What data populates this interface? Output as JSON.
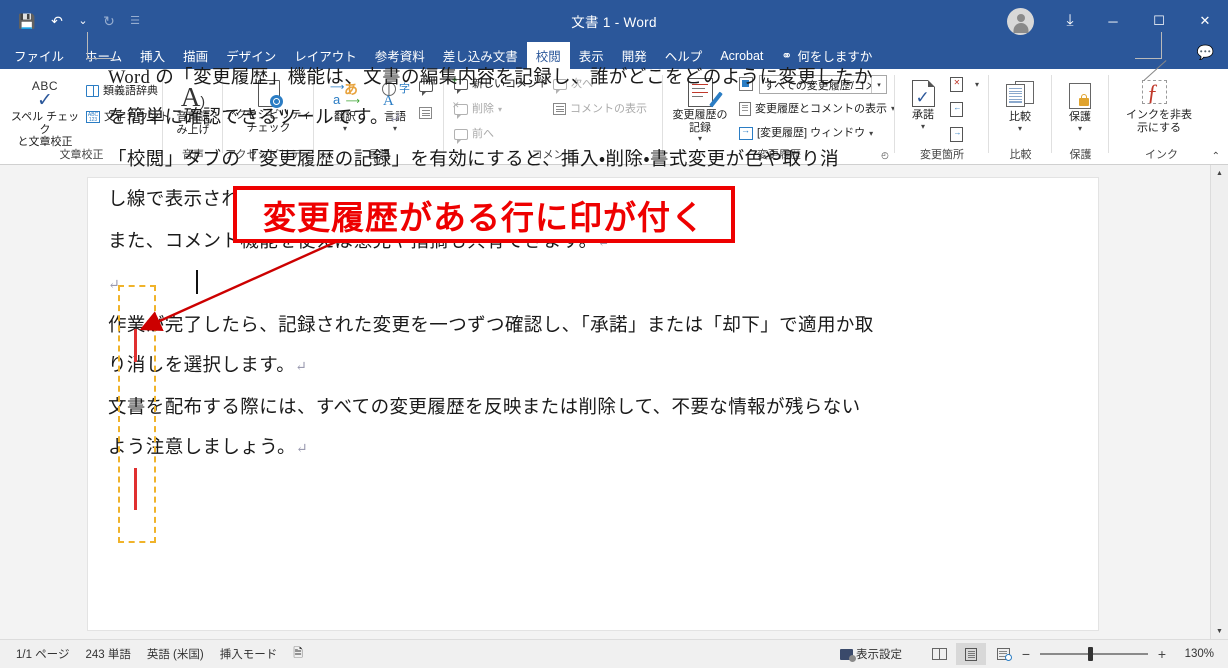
{
  "window": {
    "title": "文書 1  -  Word",
    "quick_access": [
      {
        "name": "save",
        "glyph": "💾"
      },
      {
        "name": "undo",
        "glyph": "↶"
      },
      {
        "name": "undo-dropdown",
        "glyph": "⌄"
      },
      {
        "name": "redo",
        "glyph": "↻"
      },
      {
        "name": "customize-qat",
        "glyph": "☰"
      }
    ],
    "controls": {
      "ribbon_display_options": "⤓",
      "minimize": "─",
      "maximize": "☐",
      "close": "✕",
      "comment_flag": "💬"
    }
  },
  "tabs": [
    {
      "label": "ファイル",
      "active": false
    },
    {
      "label": "ホーム",
      "active": false
    },
    {
      "label": "挿入",
      "active": false
    },
    {
      "label": "描画",
      "active": false
    },
    {
      "label": "デザイン",
      "active": false
    },
    {
      "label": "レイアウト",
      "active": false
    },
    {
      "label": "参考資料",
      "active": false
    },
    {
      "label": "差し込み文書",
      "active": false
    },
    {
      "label": "校閲",
      "active": true
    },
    {
      "label": "表示",
      "active": false
    },
    {
      "label": "開発",
      "active": false
    },
    {
      "label": "ヘルプ",
      "active": false
    },
    {
      "label": "Acrobat",
      "active": false
    }
  ],
  "tell_me": "何をしますか",
  "ribbon": {
    "groups": [
      {
        "name": "proofing",
        "label": "文章校正",
        "big_buttons": [
          {
            "name": "spelling-grammar",
            "label": "スペル チェック\nと文章校正",
            "icon": "abc-check-icon"
          }
        ],
        "small_buttons": [
          {
            "name": "thesaurus",
            "label": "類義語辞典",
            "icon": "book-icon",
            "disabled": false
          },
          {
            "name": "word-count",
            "label": "文字カウント",
            "icon": "abc123-icon",
            "disabled": false
          }
        ]
      },
      {
        "name": "speech",
        "label": "音声",
        "big_buttons": [
          {
            "name": "read-aloud",
            "label": "音声読\nみ上げ",
            "icon": "speaker-a-icon"
          }
        ],
        "small_buttons": []
      },
      {
        "name": "accessibility",
        "label": "アクセシビリティ",
        "big_buttons": [
          {
            "name": "check-accessibility",
            "label": "アクセシビリティ\nチェック",
            "icon": "accessibility-doc-icon",
            "has_chevron": true
          }
        ],
        "small_buttons": []
      },
      {
        "name": "language",
        "label": "言語",
        "big_buttons": [
          {
            "name": "translate",
            "label": "翻訳",
            "icon": "translate-icon",
            "has_chevron": true
          },
          {
            "name": "language",
            "label": "言語",
            "icon": "language-icon",
            "has_chevron": true
          }
        ],
        "small_buttons": []
      },
      {
        "name": "comments",
        "label": "コメント",
        "big_buttons": [],
        "small_buttons": [
          {
            "name": "new-comment",
            "label": "新しいコメント",
            "icon": "comment-add-icon",
            "disabled": false
          },
          {
            "name": "delete-comment",
            "label": "削除",
            "icon": "comment-delete-icon",
            "disabled": true,
            "has_chevron": true
          },
          {
            "name": "previous-comment",
            "label": "前へ",
            "icon": "comment-prev-icon",
            "disabled": true
          },
          {
            "name": "next-comment",
            "label": "次へ",
            "icon": "comment-next-icon",
            "disabled": true
          },
          {
            "name": "show-comments",
            "label": "コメントの表示",
            "icon": "comment-show-icon",
            "disabled": true
          }
        ]
      },
      {
        "name": "tracking",
        "label": "変更履歴",
        "big_buttons": [
          {
            "name": "track-changes",
            "label": "変更履歴の\n記録",
            "icon": "track-changes-icon",
            "has_chevron": true
          }
        ],
        "markup_combo": "すべての変更履歴/コメ…",
        "small_buttons": [
          {
            "name": "show-markup",
            "label": "変更履歴とコメントの表示",
            "icon": "show-markup-icon",
            "has_chevron": true
          },
          {
            "name": "reviewing-pane",
            "label": "[変更履歴] ウィンドウ",
            "icon": "reviewing-pane-icon",
            "has_chevron": true
          }
        ],
        "has_dialog_launcher": true
      },
      {
        "name": "changes",
        "label": "変更箇所",
        "big_buttons": [
          {
            "name": "accept",
            "label": "承諾",
            "icon": "accept-icon",
            "has_chevron": true
          }
        ],
        "small_buttons": [
          {
            "name": "reject",
            "label": "",
            "icon": "reject-icon",
            "has_chevron": true
          },
          {
            "name": "previous-change",
            "label": "",
            "icon": "previous-change-icon"
          },
          {
            "name": "next-change",
            "label": "",
            "icon": "next-change-icon"
          }
        ]
      },
      {
        "name": "compare",
        "label": "比較",
        "big_buttons": [
          {
            "name": "compare",
            "label": "比較",
            "icon": "compare-icon",
            "has_chevron": true
          }
        ],
        "small_buttons": []
      },
      {
        "name": "protect",
        "label": "保護",
        "big_buttons": [
          {
            "name": "protect",
            "label": "保護",
            "icon": "protect-lock-icon",
            "has_chevron": true
          }
        ],
        "small_buttons": []
      },
      {
        "name": "ink",
        "label": "インク",
        "big_buttons": [
          {
            "name": "hide-ink",
            "label": "インクを非表\n示にする",
            "icon": "hide-ink-icon",
            "has_chevron": true
          }
        ],
        "small_buttons": []
      }
    ],
    "collapse_glyph": "⌃"
  },
  "annotation": {
    "callout_text": "変更履歴がある行に印が付く",
    "callout_border_color": "#ee0000",
    "callout_text_color": "#ee0000",
    "highlight_box_color": "#f0b32a",
    "arrow_color": "#cc0000"
  },
  "document": {
    "change_bar_color": "#e03030",
    "paragraphs": [
      {
        "name": "para-1-line-1",
        "text": "Word の「変更履歴」機能は、文書の編集内容を記録し、誰がどこをどのように変更したか",
        "pilcrow": false
      },
      {
        "name": "para-1-line-2",
        "text": "を簡単に確認できるツールです。",
        "pilcrow": true
      },
      {
        "name": "para-2-line-1",
        "text": "「校閲」タブの「変更履歴の記録」を有効にすると、挿入・削除・書式変更が色や取り消",
        "pilcrow": false
      },
      {
        "name": "para-2-line-2",
        "text": "し線で表示され、編集内容が一目でわかります。",
        "pilcrow": true
      },
      {
        "name": "para-3",
        "text": "また、コメント機能を使えば意見や指摘も共有できます。",
        "pilcrow": true
      },
      {
        "name": "para-empty",
        "text": "",
        "pilcrow": true
      },
      {
        "name": "para-4-line-1",
        "text": "作業が完了したら、記録された変更を一つずつ確認し、「承諾」または「却下」で適用か取",
        "pilcrow": false
      },
      {
        "name": "para-4-line-2",
        "text": "り消しを選択します。",
        "pilcrow": true
      },
      {
        "name": "para-5-line-1",
        "text": "文書を配布する際には、すべての変更履歴を反映または削除して、不要な情報が残らない",
        "pilcrow": false
      },
      {
        "name": "para-5-line-2",
        "text": "よう注意しましょう。",
        "pilcrow": true
      }
    ]
  },
  "status_bar": {
    "page": "1/1 ページ",
    "words": "243 単語",
    "language": "英語 (米国)",
    "mode": "挿入モード",
    "proof_icon": "proofing-status-icon",
    "view_settings": "表示設定",
    "views": [
      {
        "name": "read-mode",
        "selected": false
      },
      {
        "name": "print-layout",
        "selected": true
      },
      {
        "name": "web-layout",
        "selected": false
      }
    ],
    "zoom_out": "−",
    "zoom_in": "+",
    "zoom_value": "130%"
  }
}
